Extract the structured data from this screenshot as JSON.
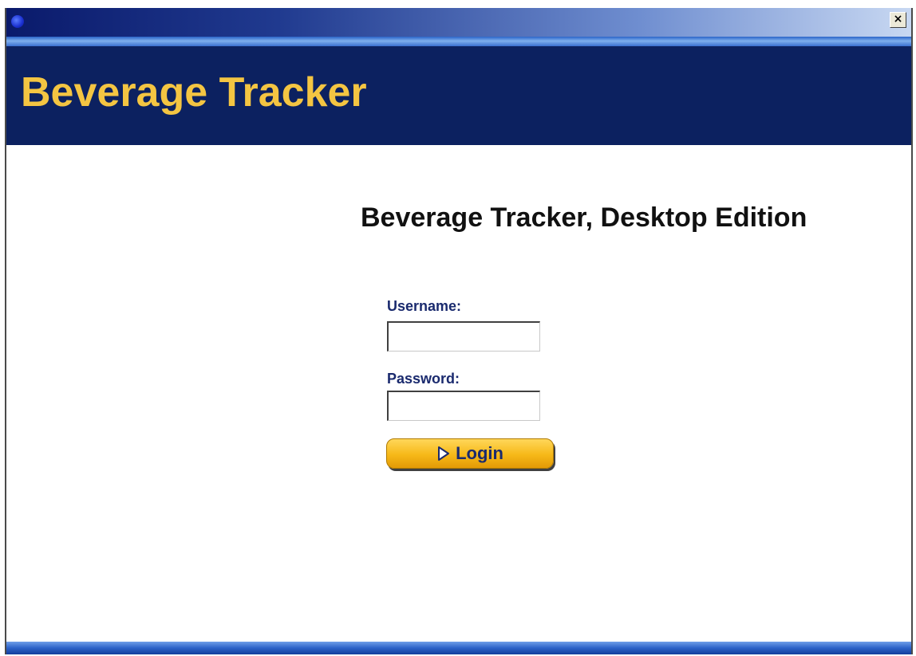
{
  "window": {
    "close_label": "×"
  },
  "header": {
    "brand": "Beverage Tracker"
  },
  "main": {
    "title": "Beverage Tracker, Desktop Edition"
  },
  "form": {
    "username_label": "Username:",
    "username_value": "",
    "password_label": "Password:",
    "password_value": "",
    "login_label": "Login"
  },
  "icons": {
    "app": "app-globe-icon",
    "close": "close-icon",
    "login_arrow": "arrow-right-icon"
  },
  "colors": {
    "header_bg": "#0c2160",
    "brand_text": "#f4c542",
    "label_text": "#1a2a6e",
    "button_yellow": "#f6b818"
  }
}
